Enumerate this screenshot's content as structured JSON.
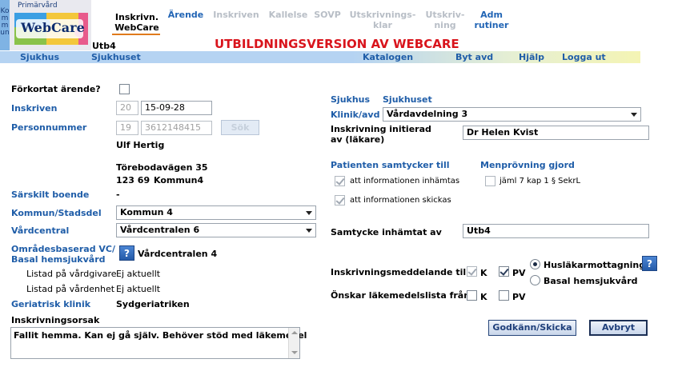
{
  "logo": {
    "top_label": "Primärvård",
    "side_label": "Kommun",
    "brand": "WebCare"
  },
  "nav": [
    {
      "line1": "Inskrivn.",
      "line2": "WebCare",
      "state": "active"
    },
    {
      "line1": "Ärende",
      "line2": "",
      "state": "link"
    },
    {
      "line1": "Inskriven",
      "line2": "",
      "state": "dim"
    },
    {
      "line1": "Kallelse",
      "line2": "",
      "state": "dim"
    },
    {
      "line1": "SOVP",
      "line2": "",
      "state": "dim"
    },
    {
      "line1": "Utskrivnings-",
      "line2": "klar",
      "state": "dim"
    },
    {
      "line1": "Utskriv-",
      "line2": "ning",
      "state": "dim"
    },
    {
      "line1": "Adm",
      "line2": "rutiner",
      "state": "link"
    }
  ],
  "header": {
    "user": "Utb4",
    "banner": "UTBILDNINGSVERSION AV WEBCARE"
  },
  "bar": {
    "org_type": "Sjukhus",
    "org_name": "Sjukhuset",
    "catalog": "Katalogen",
    "switch_unit": "Byt avd",
    "help": "Hjälp",
    "logout": "Logga ut"
  },
  "left": {
    "abbreviated_label": "Förkortat ärende?",
    "enrolled_label": "Inskriven",
    "enrolled_century": "20",
    "enrolled_date": "15-09-28",
    "pnr_label": "Personnummer",
    "pnr_century": "19",
    "pnr_number": "3612148415",
    "search_button": "Sök",
    "patient_name": "Ulf Hertig",
    "address_street": "Törebodavägen 35",
    "address_zip": "123 69",
    "address_city": "Kommun4",
    "special_housing_label": "Särskilt boende",
    "special_housing_value": "-",
    "municipality_label": "Kommun/Stadsdel",
    "municipality_value": "Kommun 4",
    "health_center_label": "Vårdcentral",
    "health_center_value": "Vårdcentralen 6",
    "area_label_1": "Områdesbaserad VC/",
    "area_label_2": "Basal hemsjukvård",
    "area_help": "?",
    "area_value": "Vårdcentralen 4",
    "listed_provider_label": "Listad på vårdgivare",
    "listed_provider_value": "Ej aktuellt",
    "listed_unit_label": "Listad på vårdenhet",
    "listed_unit_value": "Ej aktuellt",
    "geriatric_label": "Geriatrisk klinik",
    "geriatric_value": "Sydgeriatriken",
    "reason_label": "Inskrivningsorsak",
    "reason_value": "Fallit hemma. Kan ej gå själv. Behöver stöd med läkemedel"
  },
  "right": {
    "hospital_label": "Sjukhus",
    "hospital_value": "Sjukhuset",
    "clinic_label": "Klinik/avd",
    "clinic_value": "Vårdavdelning 3",
    "initiated_label_1": "Inskrivning initierad",
    "initiated_label_2": "av (läkare)",
    "initiated_value": "Dr Helen Kvist",
    "consent_title": "Patienten samtycker till",
    "consent_collect": "att informationen inhämtas",
    "consent_send": "att informationen skickas",
    "harm_title": "Menprövning gjord",
    "harm_ref": "jäml 7 kap 1 § SekrL",
    "consent_by_label": "Samtycke inhämtat av",
    "consent_by_value": "Utb4",
    "notice_label": "Inskrivningsmeddelande till",
    "k_label": "K",
    "pv_label": "PV",
    "opt_family": "Husläkarmottagning",
    "opt_basal": "Basal hemsjukvård",
    "notice_help": "?",
    "medlist_label": "Önskar läkemedelslista från",
    "approve_button": "Godkänn/Skicka",
    "cancel_button": "Avbryt"
  },
  "colors": {
    "banner": "#d9141c",
    "link": "#1f5da8",
    "bar_start": "#b5d3f2",
    "bar_end": "#f4f4b4"
  }
}
